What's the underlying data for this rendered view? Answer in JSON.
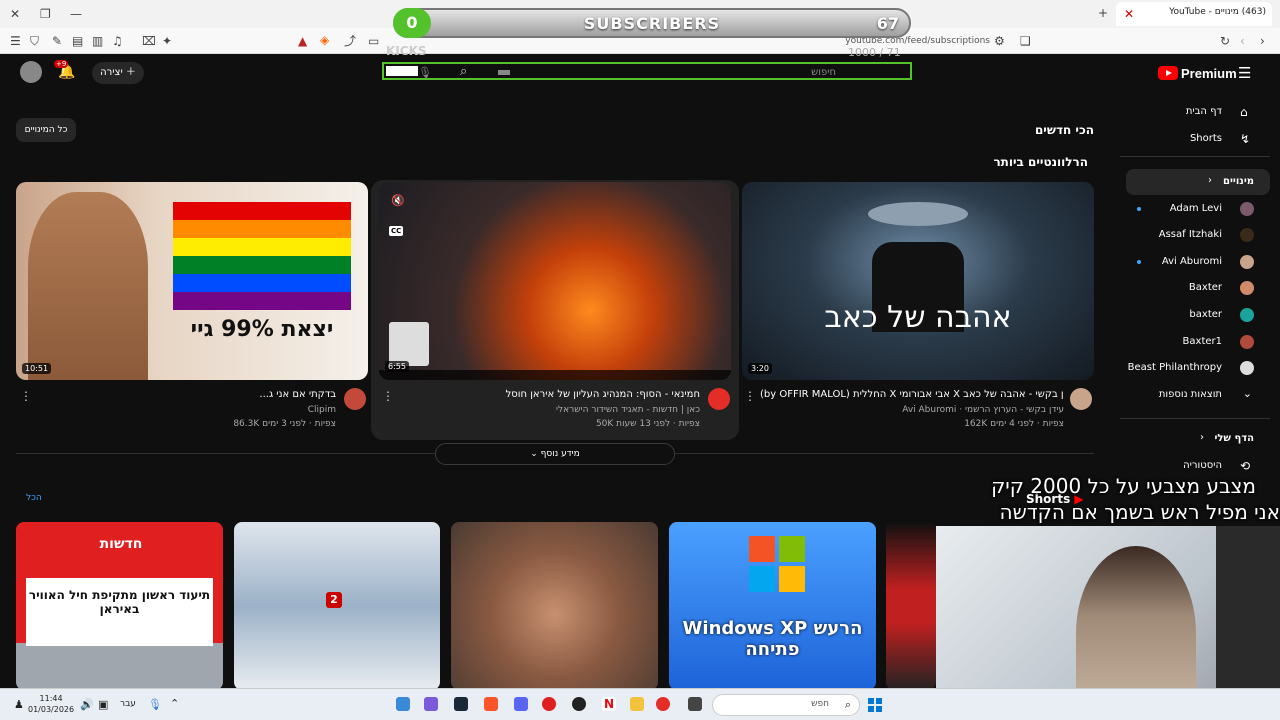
{
  "browser": {
    "tab_title": "(463) מינויים - YouTube",
    "url": "youtube.com/feed/subscriptions"
  },
  "overlay": {
    "sub_count": "0",
    "sub_label": "SUBSCRIBERS",
    "sub_goal": "67",
    "kicks_label": "KICKS",
    "kicks_progress": "1000 / 71"
  },
  "header": {
    "logo_text": "Premium",
    "search_placeholder": "חיפוש",
    "create_label": "יצירה",
    "notif_badge": "+9"
  },
  "sidebar": {
    "items": [
      {
        "label": "דף הבית",
        "icon": "home-icon"
      },
      {
        "label": "Shorts",
        "icon": "shorts-icon"
      }
    ],
    "subs_header": "מינויים",
    "subs": [
      {
        "label": "Adam Levi",
        "dot": true,
        "color": "#7a5a6b"
      },
      {
        "label": "Assaf Itzhaki",
        "dot": false,
        "color": "#3a2a1a"
      },
      {
        "label": "Avi Aburomi",
        "dot": true,
        "color": "#c8a58a"
      },
      {
        "label": "Baxter",
        "dot": false,
        "color": "#d28a6a"
      },
      {
        "label": "baxter",
        "dot": false,
        "color": "#1aa39a"
      },
      {
        "label": "Baxter1",
        "dot": false,
        "color": "#b04a3a"
      },
      {
        "label": "Beast Philanthropy",
        "dot": false,
        "color": "#dddddd"
      }
    ],
    "more_results": "תוצאות נוספות",
    "you_header": "הדף שלי",
    "history": "היסטוריה"
  },
  "main": {
    "chip_all_subs": "כל המינויים",
    "latest": "הכי חדשים",
    "most_relevant": "הרלוונטיים ביותר",
    "show_more": "מידע נוסף",
    "all_link": "הכל",
    "shorts_label": "Shorts",
    "videos": [
      {
        "title": "...בדקתי אם אני ג",
        "channel": "Clipim",
        "meta": "86.3K צפיות · לפני 3 ימים",
        "duration": "10:51",
        "thumb_text": "יצאת 99% גיי"
      },
      {
        "title": "חמינאי - הסוף: המנהיג העליון של איראן חוסל",
        "channel": "כאן | חדשות - תאגיד השידור הישראלי",
        "meta": "50K צפיות · לפני 13 שעות",
        "duration": "6:55"
      },
      {
        "title": "(by OFFIR MALOL) החללית X אבי אבורומי X עידן בקשי - אהבה של כאב",
        "channel": "Avi Aburomi · עידן בקשי - הערוץ הרשמי",
        "meta": "162K צפיות · לפני 4 ימים",
        "duration": "3:20",
        "thumb_text": "אהבה של כאב"
      }
    ],
    "shorts": [
      {
        "brand": "חדשות",
        "caption": "תיעוד ראשון מתקיפת חיל האוויר באיראן"
      },
      {
        "caption": "2"
      },
      {
        "caption": ""
      },
      {
        "caption": "Windows XP הרעש פתיחה"
      }
    ]
  },
  "stream_captions": {
    "line1": "מצבע מצבעי על כל 2000 קיק",
    "line2": "אני מפיל ראש בשמך  אם הקדשה"
  },
  "taskbar": {
    "time": "11:44",
    "date": "01/03/2026",
    "lang": "עבר",
    "search_placeholder": "חפש"
  }
}
